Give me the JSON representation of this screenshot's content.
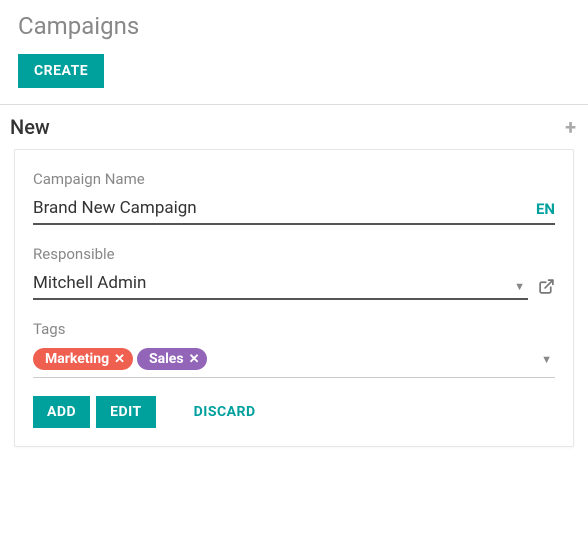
{
  "header": {
    "title": "Campaigns",
    "create_label": "CREATE"
  },
  "stage": {
    "title": "New"
  },
  "form": {
    "campaign_name": {
      "label": "Campaign Name",
      "value": "Brand New Campaign",
      "lang": "EN"
    },
    "responsible": {
      "label": "Responsible",
      "value": "Mitchell Admin"
    },
    "tags": {
      "label": "Tags",
      "items": [
        {
          "label": "Marketing",
          "color": "#f06050"
        },
        {
          "label": "Sales",
          "color": "#9365b8"
        }
      ]
    }
  },
  "actions": {
    "add": "ADD",
    "edit": "EDIT",
    "discard": "DISCARD"
  }
}
